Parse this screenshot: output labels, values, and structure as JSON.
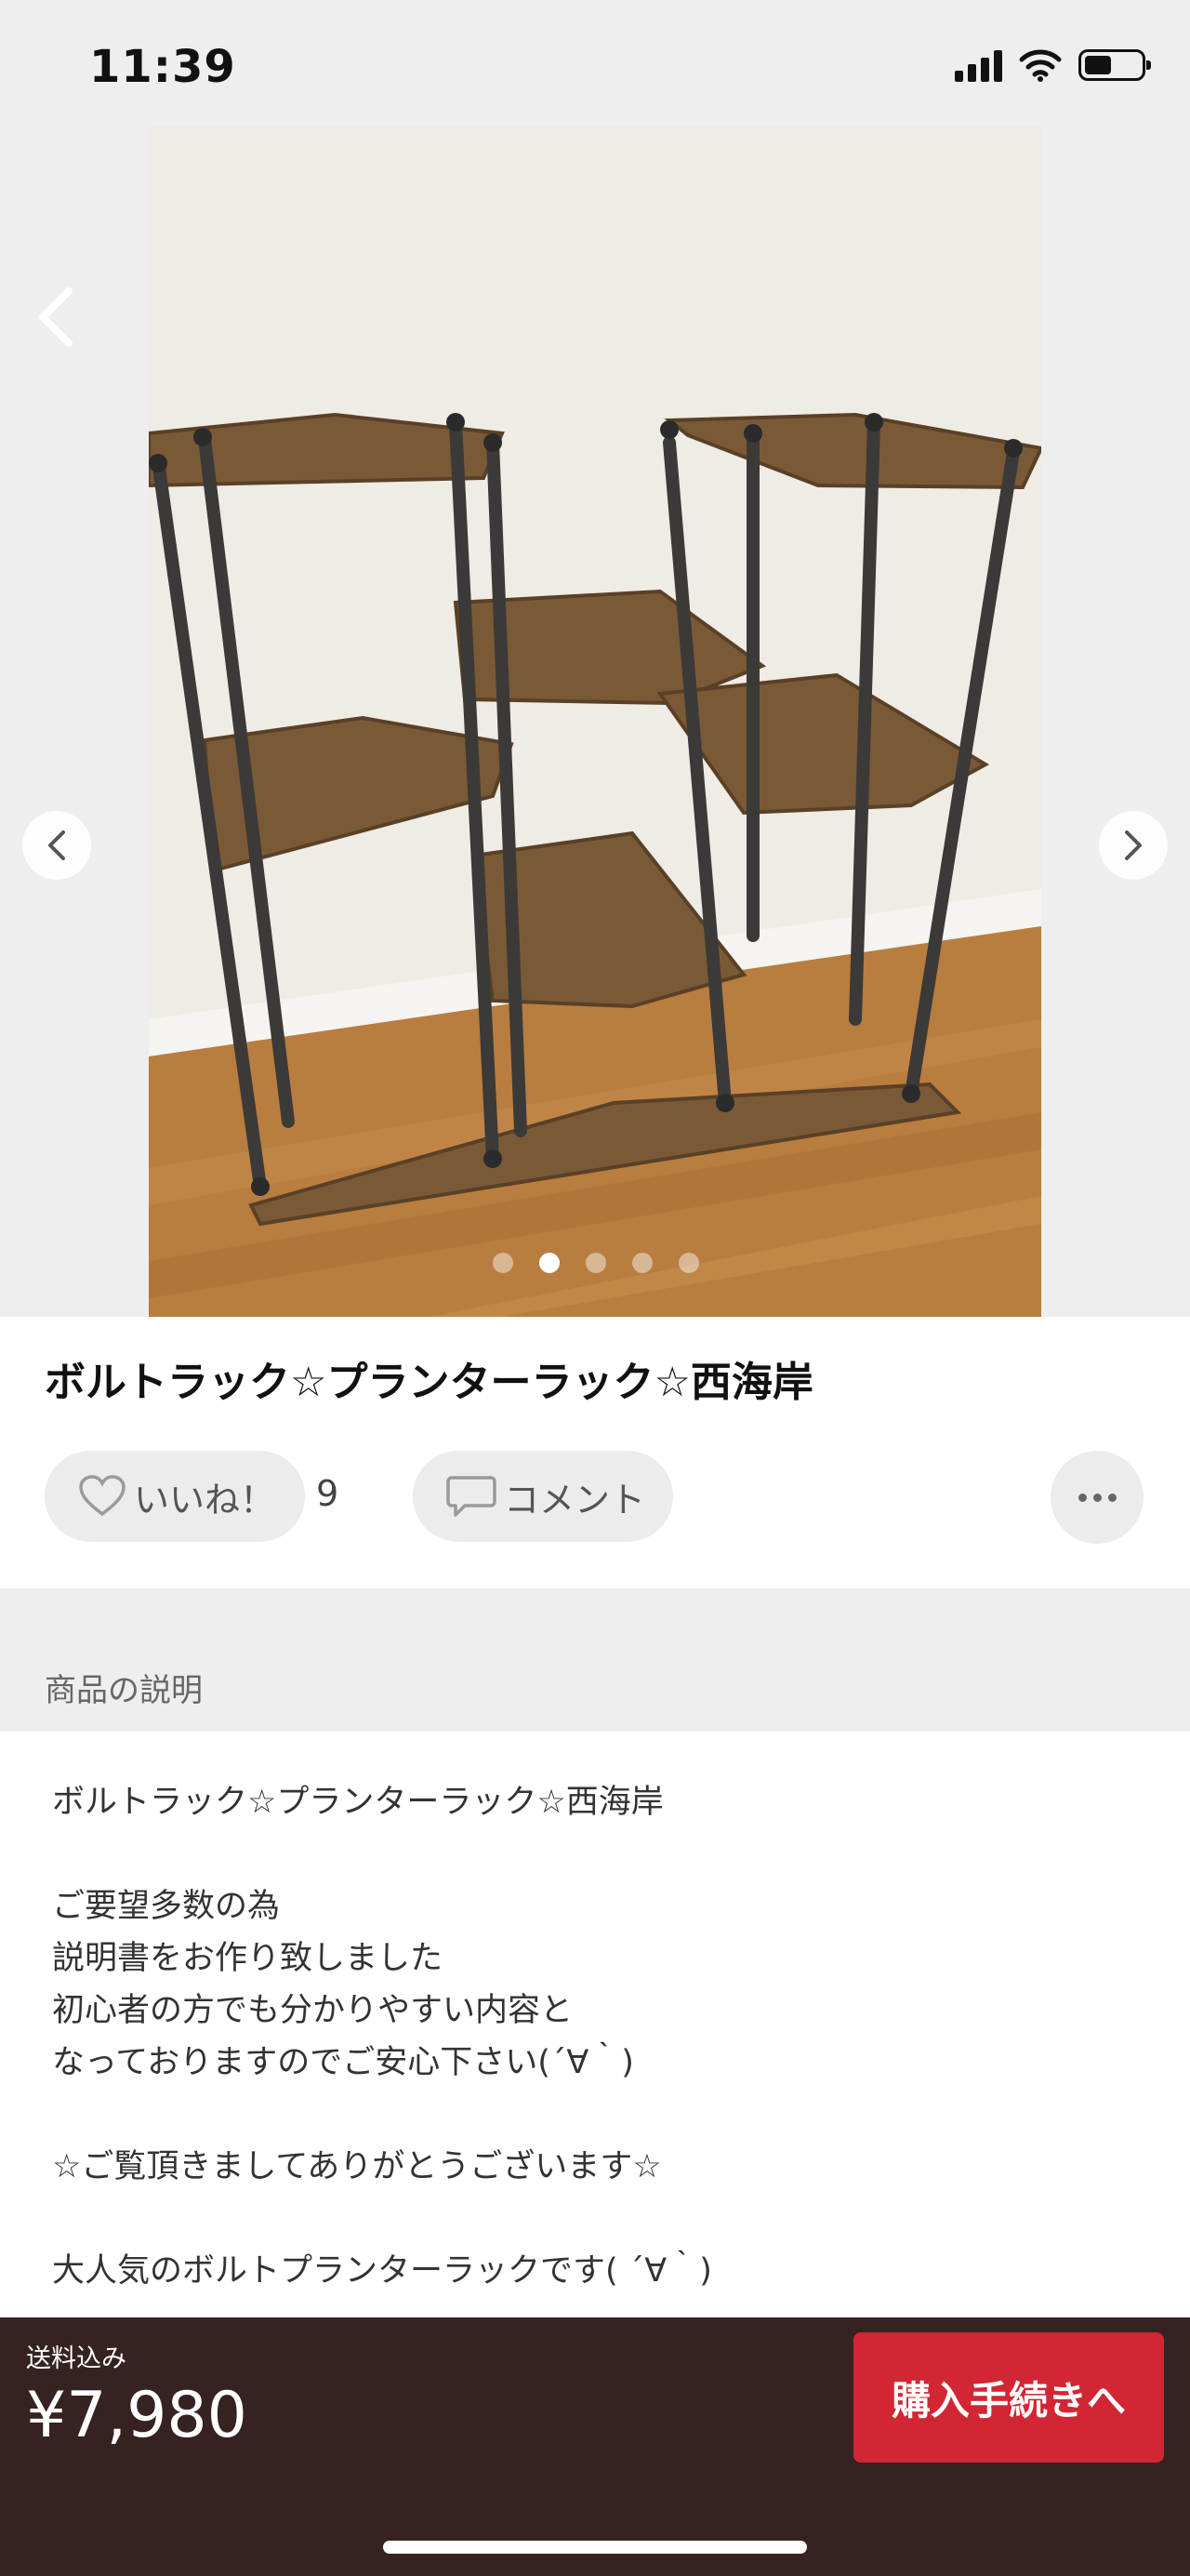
{
  "status_bar": {
    "time": "11:39"
  },
  "product": {
    "title": "ボルトラック☆プランターラック☆西海岸",
    "image_count": 5,
    "active_image": 2
  },
  "actions": {
    "like_label": "いいね！",
    "like_count": "9",
    "comment_label": "コメント"
  },
  "description": {
    "header": "商品の説明",
    "lines": [
      "ボルトラック☆プランターラック☆西海岸",
      "",
      "ご要望多数の為",
      "説明書をお作り致しました",
      "初心者の方でも分かりやすい内容と",
      "なっておりますのでご安心下さい(´∀｀)",
      "",
      "☆ご覧頂きましてありがとうございます☆",
      "",
      "大人気のボルトプランターラックです( ´∀｀)"
    ]
  },
  "purchase": {
    "shipping_label": "送料込み",
    "price": "¥7,980",
    "buy_label": "購入手続きへ"
  },
  "icons": [
    "back-icon",
    "chevron-left-icon",
    "chevron-right-icon",
    "heart-icon",
    "comment-icon",
    "more-icon",
    "signal-icon",
    "wifi-icon",
    "battery-icon"
  ]
}
